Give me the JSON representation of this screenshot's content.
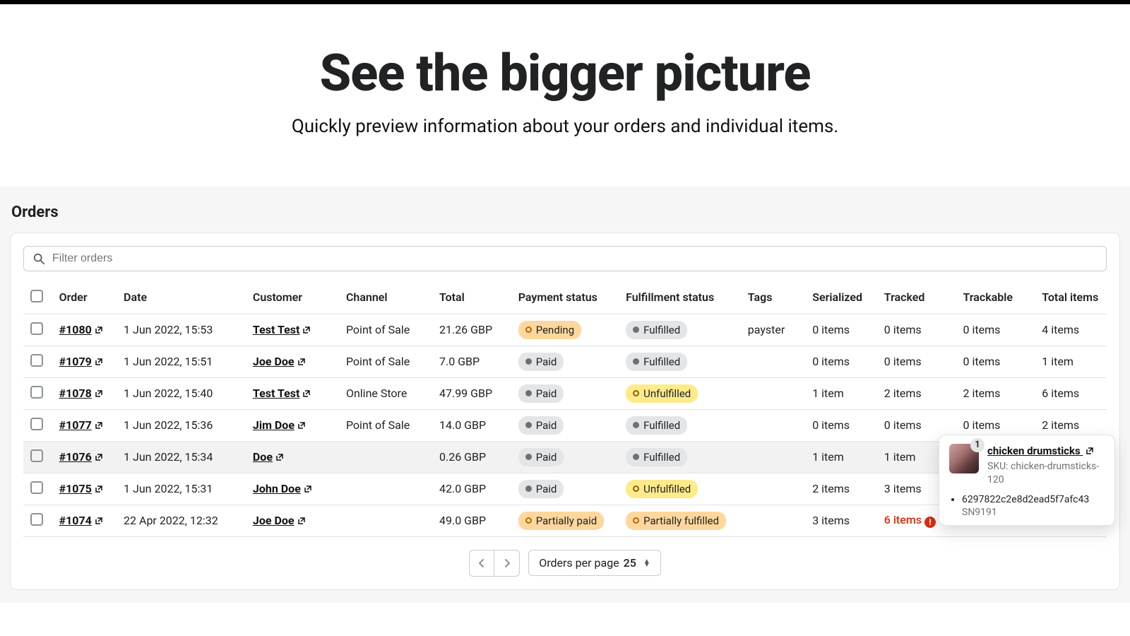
{
  "hero": {
    "title": "See the bigger picture",
    "subtitle": "Quickly preview information about your orders and individual items."
  },
  "panel": {
    "title": "Orders"
  },
  "filter": {
    "placeholder": "Filter orders"
  },
  "columns": {
    "order": "Order",
    "date": "Date",
    "customer": "Customer",
    "channel": "Channel",
    "total": "Total",
    "payment": "Payment status",
    "fulfillment": "Fulfillment status",
    "tags": "Tags",
    "serialized": "Serialized",
    "tracked": "Tracked",
    "trackable": "Trackable",
    "totalitems": "Total items"
  },
  "rows": [
    {
      "id": "#1080",
      "date": "1 Jun 2022, 15:53",
      "customer": "Test Test",
      "channel": "Point of Sale",
      "total": "21.26 GBP",
      "pay": "Pending",
      "pay_style": "orange",
      "ful": "Fulfilled",
      "ful_style": "gray",
      "tags": "payster",
      "ser": "0 items",
      "trk": "0 items",
      "tka": "0 items",
      "tot": "4 items"
    },
    {
      "id": "#1079",
      "date": "1 Jun 2022, 15:51",
      "customer": "Joe Doe",
      "channel": "Point of Sale",
      "total": "7.0 GBP",
      "pay": "Paid",
      "pay_style": "gray",
      "ful": "Fulfilled",
      "ful_style": "gray",
      "tags": "",
      "ser": "0 items",
      "trk": "0 items",
      "tka": "0 items",
      "tot": "1 item"
    },
    {
      "id": "#1078",
      "date": "1 Jun 2022, 15:40",
      "customer": "Test Test",
      "channel": "Online Store",
      "total": "47.99 GBP",
      "pay": "Paid",
      "pay_style": "gray",
      "ful": "Unfulfilled",
      "ful_style": "yellow",
      "tags": "",
      "ser": "1 item",
      "trk": "2 items",
      "tka": "2 items",
      "tot": "6 items"
    },
    {
      "id": "#1077",
      "date": "1 Jun 2022, 15:36",
      "customer": "Jim Doe",
      "channel": "Point of Sale",
      "total": "14.0 GBP",
      "pay": "Paid",
      "pay_style": "gray",
      "ful": "Fulfilled",
      "ful_style": "gray",
      "tags": "",
      "ser": "0 items",
      "trk": "0 items",
      "tka": "0 items",
      "tot": "2 items"
    },
    {
      "id": "#1076",
      "date": "1 Jun 2022, 15:34",
      "customer": "Doe",
      "channel": "",
      "total": "0.26 GBP",
      "pay": "Paid",
      "pay_style": "gray",
      "ful": "Fulfilled",
      "ful_style": "gray",
      "tags": "",
      "ser": "1 item",
      "trk": "1 item",
      "tka": "1 item",
      "tot": "1 item",
      "expand": true,
      "hl": true
    },
    {
      "id": "#1075",
      "date": "1 Jun 2022, 15:31",
      "customer": "John Doe",
      "channel": "",
      "total": "42.0 GBP",
      "pay": "Paid",
      "pay_style": "gray",
      "ful": "Unfulfilled",
      "ful_style": "yellow",
      "tags": "",
      "ser": "2 items",
      "trk": "3 items",
      "tka": "",
      "tot": ""
    },
    {
      "id": "#1074",
      "date": "22 Apr 2022, 12:32",
      "customer": "Joe Doe",
      "channel": "",
      "total": "49.0 GBP",
      "pay": "Partially paid",
      "pay_style": "orange",
      "ful": "Partially fulfilled",
      "ful_style": "orange",
      "tags": "",
      "ser": "3 items",
      "trk": "6 items",
      "trk_alert": true,
      "tka": "",
      "tot": ""
    }
  ],
  "pager": {
    "label": "Orders per page",
    "value": "25"
  },
  "popover": {
    "badge": "1",
    "title": "chicken drumsticks",
    "sku": "SKU: chicken-drumsticks-120",
    "serial": "6297822c2e8d2ead5f7afc43",
    "sn": "SN9191"
  }
}
